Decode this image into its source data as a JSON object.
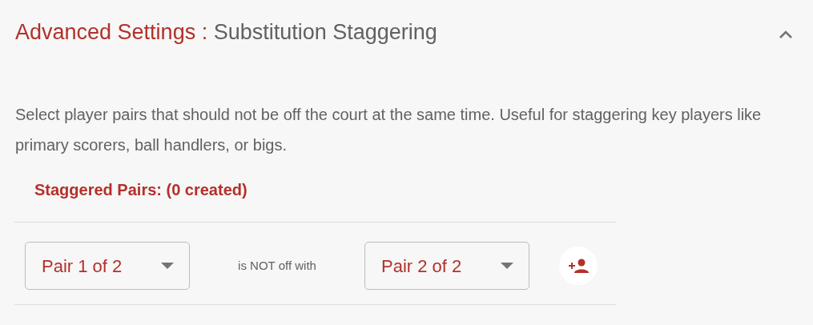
{
  "panel": {
    "title_prefix": "Advanced Settings :",
    "title": "Substitution Staggering",
    "expanded": true
  },
  "description": "Select player pairs that should not be off the court at the same time. Useful for staggering key players like primary scorers, ball handlers, or bigs.",
  "pairs_heading": "Staggered Pairs: (0 created)",
  "pair_row": {
    "first": {
      "value": "Pair 1 of 2"
    },
    "connector": "is NOT off with",
    "second": {
      "value": "Pair 2 of 2"
    }
  }
}
